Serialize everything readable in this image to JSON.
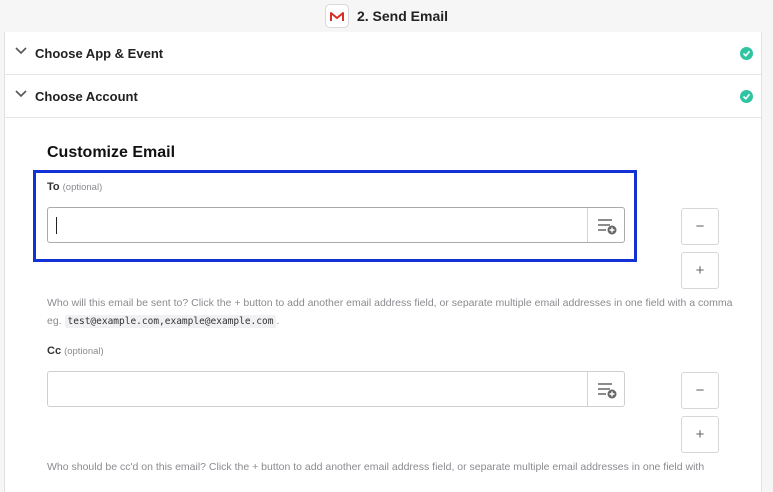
{
  "header": {
    "title": "2. Send Email",
    "app_icon": "gmail-logo-icon",
    "brand_color": "#d93025"
  },
  "steps": [
    {
      "label": "Choose App & Event",
      "status": "complete"
    },
    {
      "label": "Choose Account",
      "status": "complete"
    }
  ],
  "form": {
    "section_title": "Customize Email",
    "to": {
      "label": "To",
      "optional_tag": "(optional)",
      "value": "",
      "help_prefix": "Who will this email be sent to? Click the + button to add another email address field, or separate multiple email addresses in one field with a comma eg.",
      "help_example": "test@example.com,example@example.com",
      "help_suffix": "."
    },
    "cc": {
      "label": "Cc",
      "optional_tag": "(optional)",
      "value": "",
      "help_text": "Who should be cc'd on this email? Click the + button to add another email address field, or separate multiple email addresses in one field with"
    },
    "remove_label": "−",
    "add_label": "+"
  },
  "colors": {
    "check": "#2fc4a1",
    "highlight": "#1332d6"
  }
}
